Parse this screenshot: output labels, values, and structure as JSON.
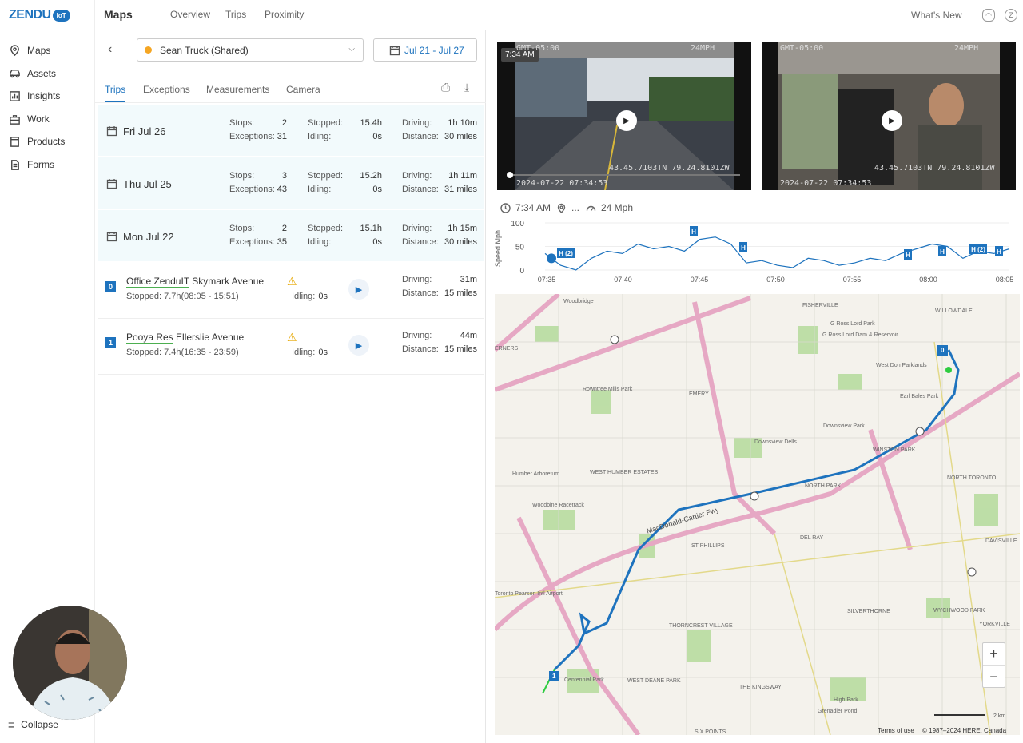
{
  "logo": {
    "text": "ZENDU",
    "badge": "IoT"
  },
  "sidebar": {
    "items": [
      {
        "label": "Maps",
        "icon": "map-pin-icon"
      },
      {
        "label": "Assets",
        "icon": "car-icon"
      },
      {
        "label": "Insights",
        "icon": "bar-chart-icon"
      },
      {
        "label": "Work",
        "icon": "briefcase-icon"
      },
      {
        "label": "Products",
        "icon": "box-icon"
      },
      {
        "label": "Forms",
        "icon": "document-icon"
      }
    ],
    "collapse": "Collapse"
  },
  "header": {
    "title": "Maps",
    "tabs": [
      "Overview",
      "Trips",
      "Proximity"
    ],
    "whats_new": "What's New",
    "avatar": "Z"
  },
  "panel": {
    "asset": "Sean Truck (Shared)",
    "asset_color": "#f5a623",
    "date_range": "Jul 21 - Jul 27",
    "tabs": [
      "Trips",
      "Exceptions",
      "Measurements",
      "Camera"
    ],
    "active_tab": "Trips",
    "labels": {
      "stops": "Stops:",
      "exceptions": "Exceptions:",
      "stopped": "Stopped:",
      "idling": "Idling:",
      "driving": "Driving:",
      "distance": "Distance:"
    },
    "days": [
      {
        "date": "Fri Jul 26",
        "stops": "2",
        "exceptions": "31",
        "stopped": "15.4h",
        "idling": "0s",
        "driving": "1h 10m",
        "distance": "30 miles"
      },
      {
        "date": "Thu Jul 25",
        "stops": "3",
        "exceptions": "43",
        "stopped": "15.2h",
        "idling": "0s",
        "driving": "1h 11m",
        "distance": "31 miles"
      },
      {
        "date": "Mon Jul 22",
        "stops": "2",
        "exceptions": "35",
        "stopped": "15.1h",
        "idling": "0s",
        "driving": "1h 15m",
        "distance": "30 miles"
      }
    ],
    "trips": [
      {
        "num": "0",
        "place": "Office ZenduIT",
        "street": " Skymark Avenue",
        "stopped": "Stopped:  7.7h(08:05 - 15:51)",
        "idling_label": "Idling:",
        "idling": "0s",
        "driving": "31m",
        "distance": "15 miles"
      },
      {
        "num": "1",
        "place": "Pooya Res",
        "street": " Ellerslie Avenue",
        "stopped": "Stopped:  7.4h(16:35 - 23:59)",
        "idling_label": "Idling:",
        "idling": "0s",
        "driving": "44m",
        "distance": "15 miles"
      }
    ]
  },
  "video": {
    "badge_time": "7:34 AM",
    "front": {
      "tz": "GMT-05:00",
      "speed": "24MPH",
      "coords": "43.45.7103TN 79.24.8101ZW",
      "timestamp": "2024-07-22 07:34:53"
    },
    "cabin": {
      "tz": "GMT-05:00",
      "speed": "24MPH",
      "coords": "43.45.7103TN 79.24.8101ZW",
      "timestamp": "2024-07-22 07:34:53"
    }
  },
  "info": {
    "time": "7:34 AM",
    "location": "...",
    "speed": "24 Mph"
  },
  "chart_data": {
    "type": "line",
    "ylabel": "Speed Mph",
    "ylim": [
      0,
      100
    ],
    "yticks": [
      "100",
      "50",
      "0"
    ],
    "xticks": [
      "07:35",
      "07:40",
      "07:45",
      "07:50",
      "07:55",
      "08:00",
      "08:05"
    ],
    "x": [
      0,
      1,
      2,
      3,
      4,
      5,
      6,
      7,
      8,
      9,
      10,
      11,
      12,
      13,
      14,
      15,
      16,
      17,
      18,
      19,
      20,
      21,
      22,
      23,
      24,
      25,
      26,
      27,
      28,
      29,
      30
    ],
    "values": [
      35,
      10,
      0,
      25,
      40,
      35,
      55,
      45,
      50,
      40,
      65,
      70,
      55,
      15,
      20,
      10,
      5,
      25,
      20,
      10,
      15,
      25,
      20,
      35,
      45,
      55,
      50,
      25,
      40,
      35,
      45
    ],
    "markers": [
      "H (2)",
      "H",
      "H",
      "H",
      "H",
      "H (2)",
      "H"
    ],
    "color": "#1e73be"
  },
  "map": {
    "labels": [
      "Woodbridge",
      "FISHERVILLE",
      "WILLOWDALE",
      "G Ross Lord Park",
      "G Ross Lord Dam & Reservoir",
      "West Don Parklands",
      "Earl Bales Park",
      "Downsview Park",
      "Downsview Dells",
      "WINSTON PARK",
      "NORTH PARK",
      "NORTH TORONTO",
      "Rowntree Mills Park",
      "EMERY",
      "Humber Arboretum",
      "WEST HUMBER ESTATES",
      "Woodbine Racetrack",
      "MacDonald-Cartier Fwy",
      "ST PHILLIPS",
      "DEL RAY",
      "SILVERTHORNE",
      "WYCHWOOD PARK",
      "DAVISVILLE",
      "YORKVILLE",
      "THORNCREST VILLAGE",
      "Centennial Park",
      "WEST DEANE PARK",
      "THE KINGSWAY",
      "High Park",
      "Grenadier Pond",
      "SIX POINTS",
      "Toronto Pearson Intl Airport",
      "ERNERS"
    ],
    "stop_start": "0",
    "stop_end": "1",
    "terms": "Terms of use",
    "copyright": "© 1987–2024 HERE, Canada",
    "scale": "2 km"
  },
  "zoom": {
    "in": "+",
    "out": "−"
  }
}
